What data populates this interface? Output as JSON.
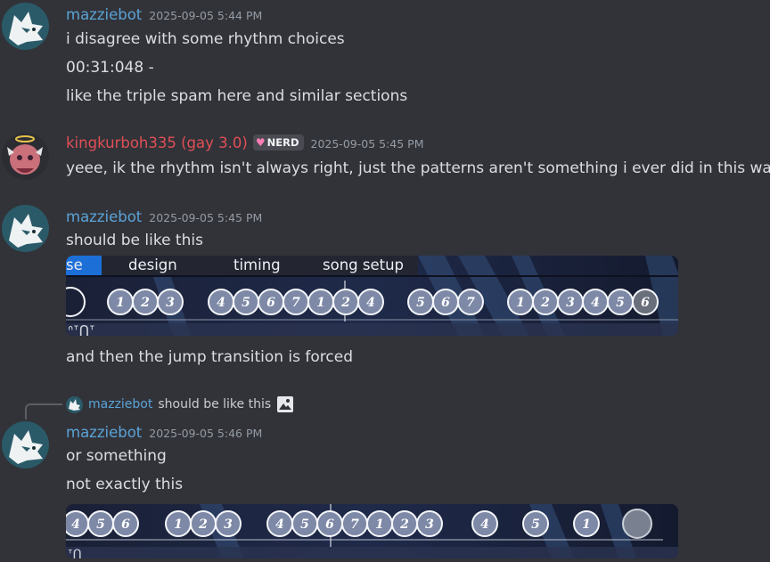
{
  "messages": [
    {
      "user": "mazziebot",
      "time": "2025-09-05 5:44 PM",
      "lines": [
        "i disagree with some rhythm choices",
        "00:31:048 -",
        "like the triple spam here and similar sections"
      ]
    },
    {
      "user": "kingkurboh335 (gay 3.0)",
      "badge": "NERD",
      "time": "2025-09-05 5:45 PM",
      "lines": [
        "yeee, ik the rhythm isn't always right, just the patterns aren't something i ever did in this way"
      ]
    },
    {
      "user": "mazziebot",
      "time": "2025-09-05 5:45 PM",
      "lines": [
        "should be like this"
      ],
      "embed": {
        "menu": [
          "se",
          "design",
          "timing",
          "song setup"
        ],
        "circles": [
          "1",
          "2",
          "3",
          "4",
          "5",
          "6",
          "7",
          "1",
          "2",
          "4",
          "5",
          "6",
          "7",
          "1",
          "2",
          "3",
          "4",
          "5",
          "6"
        ],
        "partial_text": "ᐢᐪᑎᐪ"
      },
      "after": "and then the jump transition is forced"
    },
    {
      "reply": {
        "user": "mazziebot",
        "text": "should be like this"
      },
      "user": "mazziebot",
      "time": "2025-09-05 5:46 PM",
      "lines": [
        "or something",
        "not exactly this"
      ],
      "embed": {
        "circles": [
          "4",
          "5",
          "6",
          "1",
          "2",
          "3",
          "4",
          "5",
          "6",
          "7",
          "1",
          "2",
          "3",
          "4",
          "5",
          "1"
        ],
        "partial_text": "ᐪᑎ"
      }
    }
  ],
  "colors": {
    "username": "#5aa3d6",
    "username_red": "#e04f55",
    "bg": "#323339"
  },
  "icons": [
    "wolf-avatar",
    "character-avatar",
    "heart-icon",
    "image-icon"
  ]
}
